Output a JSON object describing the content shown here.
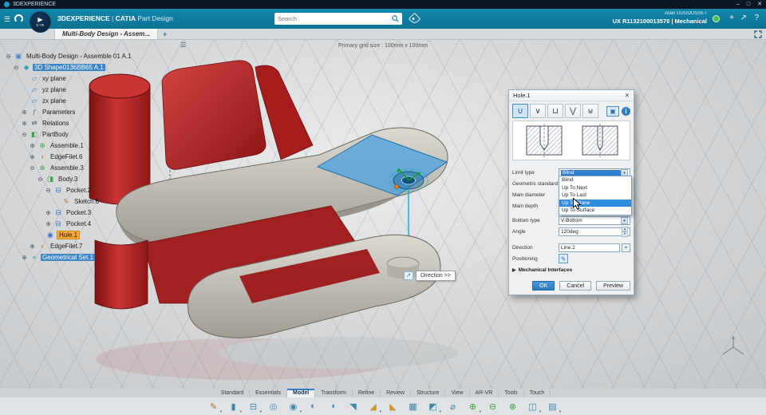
{
  "window": {
    "title": "3DEXPERIENCE",
    "controls": [
      "–",
      "□",
      "✕"
    ]
  },
  "header": {
    "brand": "3DEXPERIENCE",
    "separator": "|",
    "app": "CATIA",
    "app_module": "Part Design",
    "compass_label": "V+R",
    "search": {
      "placeholder": "Search"
    },
    "user": {
      "name": "Alain DUGOUSSET",
      "session": "UX R1132100013579 | Mechanical"
    }
  },
  "tabbar": {
    "tabs": [
      {
        "label": "Multi-Body Design - Assem...",
        "active": true
      }
    ],
    "add_label": "+"
  },
  "viewport": {
    "grid_label": "Primary grid size : 100mm x 100mm",
    "direction_tooltip": "Direction >>"
  },
  "tree": {
    "icon_glyphs": {
      "assembly": "▣",
      "shape": "◆",
      "plane": "▱",
      "parameters": "ƒ",
      "relations": "⇄",
      "partbody": "◧",
      "assemble": "⊕",
      "fillet": "◖",
      "body": "◨",
      "pocket": "⊟",
      "sketch": "✎",
      "hole": "◉",
      "geomset": "⌖"
    },
    "icon_colors": {
      "assembly": "#4a86c8",
      "shape": "#2da3b4",
      "plane": "#4a86c8",
      "parameters": "#6a6f74",
      "relations": "#6a6f74",
      "partbody": "#3f9d4a",
      "assemble": "#3f9d4a",
      "fillet": "#c9972e",
      "body": "#3f9d4a",
      "pocket": "#3f6fc0",
      "sketch": "#b5762a",
      "hole": "#3f6fc0",
      "geomset": "#2da3b4"
    },
    "items": [
      {
        "label": "Multi-Body Design - Assemble 01 A.1",
        "level": 0,
        "icon": "assembly",
        "expand": "minus",
        "hl": null
      },
      {
        "label": "3D Shape0136BB65 A.1",
        "level": 1,
        "icon": "shape",
        "expand": "minus",
        "hl": "blue"
      },
      {
        "label": "xy plane",
        "level": 2,
        "icon": "plane",
        "expand": "none",
        "hl": null
      },
      {
        "label": "yz plane",
        "level": 2,
        "icon": "plane",
        "expand": "none",
        "hl": null
      },
      {
        "label": "zx plane",
        "level": 2,
        "icon": "plane",
        "expand": "none",
        "hl": null
      },
      {
        "label": "Parameters",
        "level": 2,
        "icon": "parameters",
        "expand": "plus",
        "hl": null
      },
      {
        "label": "Relations",
        "level": 2,
        "icon": "relations",
        "expand": "plus",
        "hl": null
      },
      {
        "label": "PartBody",
        "level": 2,
        "icon": "partbody",
        "expand": "minus",
        "hl": null
      },
      {
        "label": "Assemble.1",
        "level": 3,
        "icon": "assemble",
        "expand": "plus",
        "hl": null
      },
      {
        "label": "EdgeFilet.6",
        "level": 3,
        "icon": "fillet",
        "expand": "plus",
        "hl": null
      },
      {
        "label": "Assemble.3",
        "level": 3,
        "icon": "assemble",
        "expand": "minus",
        "hl": null
      },
      {
        "label": "Body.3",
        "level": 4,
        "icon": "body",
        "expand": "minus",
        "hl": null
      },
      {
        "label": "Pocket.2",
        "level": 5,
        "icon": "pocket",
        "expand": "minus",
        "hl": null
      },
      {
        "label": "Sketch.6",
        "level": 6,
        "icon": "sketch",
        "expand": "none",
        "hl": null
      },
      {
        "label": "Pocket.3",
        "level": 5,
        "icon": "pocket",
        "expand": "plus",
        "hl": null
      },
      {
        "label": "Pocket.4",
        "level": 5,
        "icon": "pocket",
        "expand": "plus",
        "hl": null
      },
      {
        "label": "Hole.1",
        "level": 4,
        "icon": "hole",
        "expand": "none",
        "hl": "orange"
      },
      {
        "label": "EdgeFilet.7",
        "level": 3,
        "icon": "fillet",
        "expand": "plus",
        "hl": null
      },
      {
        "label": "Geometrical Set.1",
        "level": 2,
        "icon": "geomset",
        "expand": "plus",
        "hl": "blue"
      }
    ]
  },
  "dialog": {
    "title": "Hole.1",
    "active_hole_type": "blind-hole",
    "hole_types": [
      {
        "name": "blind-hole",
        "glyph": "∪"
      },
      {
        "name": "tapered-hole",
        "glyph": "∨"
      },
      {
        "name": "counterbored-hole",
        "glyph": "⊔"
      },
      {
        "name": "countersunk-hole",
        "glyph": "⋁"
      },
      {
        "name": "counterdrilled-hole",
        "glyph": "⊎"
      }
    ],
    "fields": {
      "limit_type": {
        "label": "Limit type",
        "value": "Blind"
      },
      "geometric_standard": {
        "label": "Geometric standard"
      },
      "main_diameter": {
        "label": "Main diameter"
      },
      "main_depth": {
        "label": "Main depth"
      },
      "bottom_type": {
        "label": "Bottom type",
        "value": "V-Bottom"
      },
      "angle": {
        "label": "Angle",
        "value": "120deg"
      },
      "direction": {
        "label": "Direction",
        "value": "Line.2"
      },
      "positioning": {
        "label": "Positioning"
      }
    },
    "dropdown": {
      "options": [
        "Blind",
        "Up To Next",
        "Up To Last",
        "Up To Plane",
        "Up To Surface"
      ],
      "highlighted": "Up To Plane"
    },
    "mechanical_interfaces": "Mechanical Interfaces",
    "buttons": {
      "ok": "OK",
      "cancel": "Cancel",
      "preview": "Preview"
    }
  },
  "action_bar": {
    "active_tab": "Model",
    "tabs": [
      "Standard",
      "Essentials",
      "Model",
      "Transform",
      "Refine",
      "Review",
      "Structure",
      "View",
      "AR-VR",
      "Tools",
      "Touch"
    ],
    "icons": [
      {
        "name": "sketch",
        "glyph": "✎",
        "color": "#b07030",
        "arrow": true
      },
      {
        "name": "pad",
        "glyph": "▮",
        "color": "#3f86a8",
        "arrow": true
      },
      {
        "name": "pocket",
        "glyph": "⊟",
        "color": "#3f86a8",
        "arrow": true
      },
      {
        "name": "shaft",
        "glyph": "◎",
        "color": "#3f86a8",
        "arrow": false
      },
      {
        "name": "hole",
        "glyph": "◉",
        "color": "#3f86a8",
        "arrow": true
      },
      {
        "name": "groove",
        "glyph": "◐",
        "color": "#3f86a8",
        "arrow": false
      },
      {
        "name": "rib",
        "glyph": "◖",
        "color": "#3f86a8",
        "arrow": false
      },
      {
        "name": "stiffener",
        "glyph": "◥",
        "color": "#3f86a8",
        "arrow": false
      },
      {
        "name": "edge-fillet",
        "glyph": "◢",
        "color": "#c9972e",
        "arrow": true
      },
      {
        "name": "chamfer",
        "glyph": "◣",
        "color": "#c9972e",
        "arrow": false
      },
      {
        "name": "shell",
        "glyph": "▦",
        "color": "#3f86a8",
        "arrow": false
      },
      {
        "name": "draft",
        "glyph": "◩",
        "color": "#3f86a8",
        "arrow": true
      },
      {
        "name": "thread",
        "glyph": "⌀",
        "color": "#3f86a8",
        "arrow": false
      },
      {
        "name": "boolean-add",
        "glyph": "⊕",
        "color": "#42a048",
        "arrow": true
      },
      {
        "name": "boolean-remove",
        "glyph": "⊖",
        "color": "#42a048",
        "arrow": false
      },
      {
        "name": "boolean-intersect",
        "glyph": "⊗",
        "color": "#42a048",
        "arrow": false
      },
      {
        "name": "mirror",
        "glyph": "◫",
        "color": "#3f86a8",
        "arrow": true
      },
      {
        "name": "pattern",
        "glyph": "▤",
        "color": "#3f86a8",
        "arrow": true
      }
    ]
  }
}
